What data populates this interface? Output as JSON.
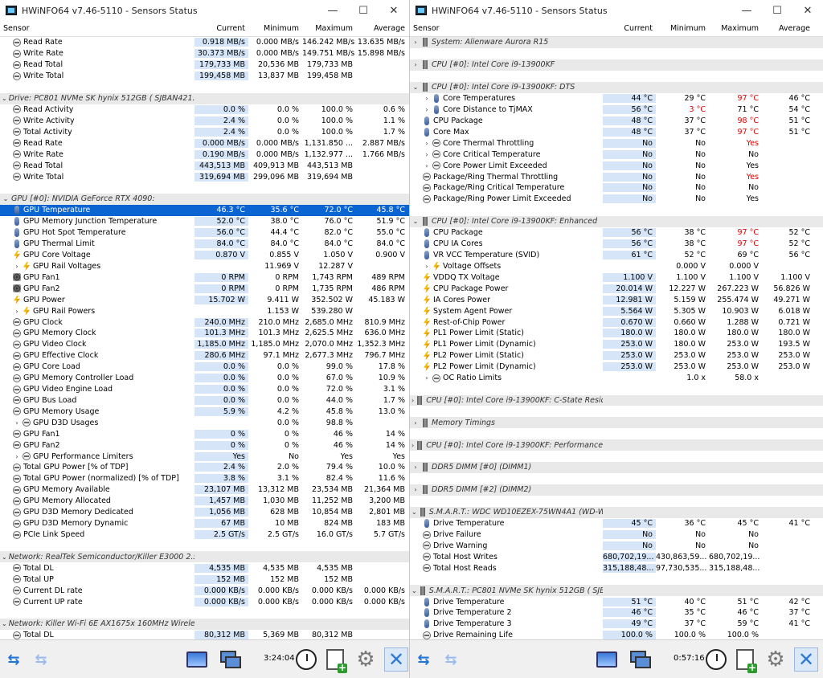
{
  "window_title": "HWiNFO64 v7.46-5110 - Sensors Status",
  "wctl": {
    "min": "—",
    "max": "☐",
    "close": "✕"
  },
  "columns": {
    "sensor": "Sensor",
    "current": "Current",
    "minimum": "Minimum",
    "maximum": "Maximum",
    "average": "Average"
  },
  "left": {
    "rows": [
      {
        "t": "s",
        "icon": "clock",
        "lbl": "Read Rate",
        "cur": "0.918 MB/s",
        "min": "0.000 MB/s",
        "max": "146.242 MB/s",
        "avg": "13.635 MB/s"
      },
      {
        "t": "s",
        "icon": "clock",
        "lbl": "Write Rate",
        "cur": "30.373 MB/s",
        "min": "0.000 MB/s",
        "max": "149.751 MB/s",
        "avg": "15.898 MB/s"
      },
      {
        "t": "s",
        "icon": "clock",
        "lbl": "Read Total",
        "cur": "179,733 MB",
        "min": "20,536 MB",
        "max": "179,733 MB",
        "avg": ""
      },
      {
        "t": "s",
        "icon": "clock",
        "lbl": "Write Total",
        "cur": "199,458 MB",
        "min": "13,837 MB",
        "max": "199,458 MB",
        "avg": ""
      },
      {
        "t": "b"
      },
      {
        "t": "g",
        "exp": "⌄",
        "lbl": "Drive: PC801 NVMe SK hynix 512GB (  SJBAN421..."
      },
      {
        "t": "s",
        "icon": "clock",
        "lbl": "Read Activity",
        "cur": "0.0 %",
        "min": "0.0 %",
        "max": "100.0 %",
        "avg": "0.6 %"
      },
      {
        "t": "s",
        "icon": "clock",
        "lbl": "Write Activity",
        "cur": "2.4 %",
        "min": "0.0 %",
        "max": "100.0 %",
        "avg": "1.1 %"
      },
      {
        "t": "s",
        "icon": "clock",
        "lbl": "Total Activity",
        "cur": "2.4 %",
        "min": "0.0 %",
        "max": "100.0 %",
        "avg": "1.7 %"
      },
      {
        "t": "s",
        "icon": "clock",
        "lbl": "Read Rate",
        "cur": "0.000 MB/s",
        "min": "0.000 MB/s",
        "max": "1,131.850 ...",
        "avg": "2.887 MB/s"
      },
      {
        "t": "s",
        "icon": "clock",
        "lbl": "Write Rate",
        "cur": "0.190 MB/s",
        "min": "0.000 MB/s",
        "max": "1,132.977 ...",
        "avg": "1.766 MB/s"
      },
      {
        "t": "s",
        "icon": "clock",
        "lbl": "Read Total",
        "cur": "443,513 MB",
        "min": "409,913 MB",
        "max": "443,513 MB",
        "avg": ""
      },
      {
        "t": "s",
        "icon": "clock",
        "lbl": "Write Total",
        "cur": "319,694 MB",
        "min": "299,096 MB",
        "max": "319,694 MB",
        "avg": ""
      },
      {
        "t": "b"
      },
      {
        "t": "g",
        "exp": "⌄",
        "lbl": "GPU [#0]: NVIDIA GeForce RTX 4090:"
      },
      {
        "t": "s",
        "icon": "therm",
        "lbl": "GPU Temperature",
        "cur": "46.3 °C",
        "min": "35.6 °C",
        "max": "72.0 °C",
        "avg": "45.8 °C",
        "sel": true
      },
      {
        "t": "s",
        "icon": "therm",
        "lbl": "GPU Memory Junction Temperature",
        "cur": "52.0 °C",
        "min": "38.0 °C",
        "max": "76.0 °C",
        "avg": "51.9 °C"
      },
      {
        "t": "s",
        "icon": "therm",
        "lbl": "GPU Hot Spot Temperature",
        "cur": "56.0 °C",
        "min": "44.4 °C",
        "max": "82.0 °C",
        "avg": "55.0 °C"
      },
      {
        "t": "s",
        "icon": "therm",
        "lbl": "GPU Thermal Limit",
        "cur": "84.0 °C",
        "min": "84.0 °C",
        "max": "84.0 °C",
        "avg": "84.0 °C"
      },
      {
        "t": "s",
        "icon": "volt",
        "lbl": "GPU Core Voltage",
        "cur": "0.870 V",
        "min": "0.855 V",
        "max": "1.050 V",
        "avg": "0.900 V"
      },
      {
        "t": "s",
        "icon": "volt",
        "exp": "›",
        "lbl": "GPU Rail Voltages",
        "cur": "",
        "min": "11.969 V",
        "max": "12.287 V",
        "avg": ""
      },
      {
        "t": "s",
        "icon": "fan",
        "lbl": "GPU Fan1",
        "cur": "0 RPM",
        "min": "0 RPM",
        "max": "1,743 RPM",
        "avg": "489 RPM"
      },
      {
        "t": "s",
        "icon": "fan",
        "lbl": "GPU Fan2",
        "cur": "0 RPM",
        "min": "0 RPM",
        "max": "1,735 RPM",
        "avg": "486 RPM"
      },
      {
        "t": "s",
        "icon": "volt",
        "lbl": "GPU Power",
        "cur": "15.702 W",
        "min": "9.411 W",
        "max": "352.502 W",
        "avg": "45.183 W"
      },
      {
        "t": "s",
        "icon": "volt",
        "exp": "›",
        "lbl": "GPU Rail Powers",
        "cur": "",
        "min": "1.153 W",
        "max": "539.280 W",
        "avg": ""
      },
      {
        "t": "s",
        "icon": "clock",
        "lbl": "GPU Clock",
        "cur": "240.0 MHz",
        "min": "210.0 MHz",
        "max": "2,685.0 MHz",
        "avg": "810.9 MHz"
      },
      {
        "t": "s",
        "icon": "clock",
        "lbl": "GPU Memory Clock",
        "cur": "101.3 MHz",
        "min": "101.3 MHz",
        "max": "2,625.5 MHz",
        "avg": "636.0 MHz"
      },
      {
        "t": "s",
        "icon": "clock",
        "lbl": "GPU Video Clock",
        "cur": "1,185.0 MHz",
        "min": "1,185.0 MHz",
        "max": "2,070.0 MHz",
        "avg": "1,352.3 MHz"
      },
      {
        "t": "s",
        "icon": "clock",
        "lbl": "GPU Effective Clock",
        "cur": "280.6 MHz",
        "min": "97.1 MHz",
        "max": "2,677.3 MHz",
        "avg": "796.7 MHz"
      },
      {
        "t": "s",
        "icon": "clock",
        "lbl": "GPU Core Load",
        "cur": "0.0 %",
        "min": "0.0 %",
        "max": "99.0 %",
        "avg": "17.8 %"
      },
      {
        "t": "s",
        "icon": "clock",
        "lbl": "GPU Memory Controller Load",
        "cur": "0.0 %",
        "min": "0.0 %",
        "max": "67.0 %",
        "avg": "10.9 %"
      },
      {
        "t": "s",
        "icon": "clock",
        "lbl": "GPU Video Engine Load",
        "cur": "0.0 %",
        "min": "0.0 %",
        "max": "72.0 %",
        "avg": "3.1 %"
      },
      {
        "t": "s",
        "icon": "clock",
        "lbl": "GPU Bus Load",
        "cur": "0.0 %",
        "min": "0.0 %",
        "max": "44.0 %",
        "avg": "1.7 %"
      },
      {
        "t": "s",
        "icon": "clock",
        "lbl": "GPU Memory Usage",
        "cur": "5.9 %",
        "min": "4.2 %",
        "max": "45.8 %",
        "avg": "13.0 %"
      },
      {
        "t": "s",
        "icon": "clock",
        "exp": "›",
        "lbl": "GPU D3D Usages",
        "cur": "",
        "min": "0.0 %",
        "max": "98.8 %",
        "avg": ""
      },
      {
        "t": "s",
        "icon": "clock",
        "lbl": "GPU Fan1",
        "cur": "0 %",
        "min": "0 %",
        "max": "46 %",
        "avg": "14 %"
      },
      {
        "t": "s",
        "icon": "clock",
        "lbl": "GPU Fan2",
        "cur": "0 %",
        "min": "0 %",
        "max": "46 %",
        "avg": "14 %"
      },
      {
        "t": "s",
        "icon": "clock",
        "exp": "›",
        "lbl": "GPU Performance Limiters",
        "cur": "Yes",
        "min": "No",
        "max": "Yes",
        "avg": "Yes"
      },
      {
        "t": "s",
        "icon": "clock",
        "lbl": "Total GPU Power [% of TDP]",
        "cur": "2.4 %",
        "min": "2.0 %",
        "max": "79.4 %",
        "avg": "10.0 %"
      },
      {
        "t": "s",
        "icon": "clock",
        "lbl": "Total GPU Power (normalized) [% of TDP]",
        "cur": "3.8 %",
        "min": "3.1 %",
        "max": "82.4 %",
        "avg": "11.6 %"
      },
      {
        "t": "s",
        "icon": "clock",
        "lbl": "GPU Memory Available",
        "cur": "23,107 MB",
        "min": "13,312 MB",
        "max": "23,534 MB",
        "avg": "21,364 MB"
      },
      {
        "t": "s",
        "icon": "clock",
        "lbl": "GPU Memory Allocated",
        "cur": "1,457 MB",
        "min": "1,030 MB",
        "max": "11,252 MB",
        "avg": "3,200 MB"
      },
      {
        "t": "s",
        "icon": "clock",
        "lbl": "GPU D3D Memory Dedicated",
        "cur": "1,056 MB",
        "min": "628 MB",
        "max": "10,854 MB",
        "avg": "2,801 MB"
      },
      {
        "t": "s",
        "icon": "clock",
        "lbl": "GPU D3D Memory Dynamic",
        "cur": "67 MB",
        "min": "10 MB",
        "max": "824 MB",
        "avg": "183 MB"
      },
      {
        "t": "s",
        "icon": "clock",
        "lbl": "PCIe Link Speed",
        "cur": "2.5 GT/s",
        "min": "2.5 GT/s",
        "max": "16.0 GT/s",
        "avg": "5.7 GT/s"
      },
      {
        "t": "b"
      },
      {
        "t": "g",
        "exp": "⌄",
        "lbl": "Network: RealTek Semiconductor/Killer E3000 2.5 ..."
      },
      {
        "t": "s",
        "icon": "clock",
        "lbl": "Total DL",
        "cur": "4,535 MB",
        "min": "4,535 MB",
        "max": "4,535 MB",
        "avg": ""
      },
      {
        "t": "s",
        "icon": "clock",
        "lbl": "Total UP",
        "cur": "152 MB",
        "min": "152 MB",
        "max": "152 MB",
        "avg": ""
      },
      {
        "t": "s",
        "icon": "clock",
        "lbl": "Current DL rate",
        "cur": "0.000 KB/s",
        "min": "0.000 KB/s",
        "max": "0.000 KB/s",
        "avg": "0.000 KB/s"
      },
      {
        "t": "s",
        "icon": "clock",
        "lbl": "Current UP rate",
        "cur": "0.000 KB/s",
        "min": "0.000 KB/s",
        "max": "0.000 KB/s",
        "avg": "0.000 KB/s"
      },
      {
        "t": "b"
      },
      {
        "t": "g",
        "exp": "⌄",
        "lbl": "Network: Killer Wi-Fi 6E AX1675x 160MHz Wireles..."
      },
      {
        "t": "s",
        "icon": "clock",
        "lbl": "Total DL",
        "cur": "80,312 MB",
        "min": "5,369 MB",
        "max": "80,312 MB",
        "avg": ""
      }
    ],
    "time": "3:24:04"
  },
  "right": {
    "rows": [
      {
        "t": "g",
        "exp": "›",
        "icon": "drive",
        "lbl": "System: Alienware Aurora R15"
      },
      {
        "t": "b"
      },
      {
        "t": "g",
        "exp": "›",
        "icon": "drive",
        "lbl": "CPU [#0]: Intel Core i9-13900KF"
      },
      {
        "t": "b"
      },
      {
        "t": "g",
        "exp": "⌄",
        "icon": "drive",
        "lbl": "CPU [#0]: Intel Core i9-13900KF: DTS"
      },
      {
        "t": "s",
        "icon": "therm",
        "exp": "›",
        "lbl": "Core Temperatures",
        "cur": "44 °C",
        "min": "29 °C",
        "max": "97 °C",
        "avg": "46 °C",
        "maxred": true
      },
      {
        "t": "s",
        "icon": "therm",
        "exp": "›",
        "lbl": "Core Distance to TjMAX",
        "cur": "56 °C",
        "min": "3 °C",
        "max": "71 °C",
        "avg": "54 °C",
        "minred": true
      },
      {
        "t": "s",
        "icon": "therm",
        "lbl": "CPU Package",
        "cur": "48 °C",
        "min": "37 °C",
        "max": "98 °C",
        "avg": "51 °C",
        "maxred": true
      },
      {
        "t": "s",
        "icon": "therm",
        "lbl": "Core Max",
        "cur": "48 °C",
        "min": "37 °C",
        "max": "97 °C",
        "avg": "51 °C",
        "maxred": true
      },
      {
        "t": "s",
        "icon": "clock",
        "exp": "›",
        "lbl": "Core Thermal Throttling",
        "cur": "No",
        "min": "No",
        "max": "Yes",
        "avg": "",
        "maxred": true
      },
      {
        "t": "s",
        "icon": "clock",
        "exp": "›",
        "lbl": "Core Critical Temperature",
        "cur": "No",
        "min": "No",
        "max": "No",
        "avg": ""
      },
      {
        "t": "s",
        "icon": "clock",
        "exp": "›",
        "lbl": "Core Power Limit Exceeded",
        "cur": "No",
        "min": "No",
        "max": "Yes",
        "avg": ""
      },
      {
        "t": "s",
        "icon": "clock",
        "lbl": "Package/Ring Thermal Throttling",
        "cur": "No",
        "min": "No",
        "max": "Yes",
        "avg": "",
        "maxred": true
      },
      {
        "t": "s",
        "icon": "clock",
        "lbl": "Package/Ring Critical Temperature",
        "cur": "No",
        "min": "No",
        "max": "No",
        "avg": ""
      },
      {
        "t": "s",
        "icon": "clock",
        "lbl": "Package/Ring Power Limit Exceeded",
        "cur": "No",
        "min": "No",
        "max": "Yes",
        "avg": ""
      },
      {
        "t": "b"
      },
      {
        "t": "g",
        "exp": "⌄",
        "icon": "drive",
        "lbl": "CPU [#0]: Intel Core i9-13900KF: Enhanced"
      },
      {
        "t": "s",
        "icon": "therm",
        "lbl": "CPU Package",
        "cur": "56 °C",
        "min": "38 °C",
        "max": "97 °C",
        "avg": "52 °C",
        "maxred": true
      },
      {
        "t": "s",
        "icon": "therm",
        "lbl": "CPU IA Cores",
        "cur": "56 °C",
        "min": "38 °C",
        "max": "97 °C",
        "avg": "52 °C",
        "maxred": true
      },
      {
        "t": "s",
        "icon": "therm",
        "lbl": "VR VCC Temperature (SVID)",
        "cur": "61 °C",
        "min": "52 °C",
        "max": "69 °C",
        "avg": "56 °C"
      },
      {
        "t": "s",
        "icon": "volt",
        "exp": "›",
        "lbl": "Voltage Offsets",
        "cur": "",
        "min": "0.000 V",
        "max": "0.000 V",
        "avg": ""
      },
      {
        "t": "s",
        "icon": "volt",
        "lbl": "VDDQ TX Voltage",
        "cur": "1.100 V",
        "min": "1.100 V",
        "max": "1.100 V",
        "avg": "1.100 V"
      },
      {
        "t": "s",
        "icon": "volt",
        "lbl": "CPU Package Power",
        "cur": "20.014 W",
        "min": "12.227 W",
        "max": "267.223 W",
        "avg": "56.826 W"
      },
      {
        "t": "s",
        "icon": "volt",
        "lbl": "IA Cores Power",
        "cur": "12.981 W",
        "min": "5.159 W",
        "max": "255.474 W",
        "avg": "49.271 W"
      },
      {
        "t": "s",
        "icon": "volt",
        "lbl": "System Agent Power",
        "cur": "5.564 W",
        "min": "5.305 W",
        "max": "10.903 W",
        "avg": "6.018 W"
      },
      {
        "t": "s",
        "icon": "volt",
        "lbl": "Rest-of-Chip Power",
        "cur": "0.670 W",
        "min": "0.660 W",
        "max": "1.288 W",
        "avg": "0.721 W"
      },
      {
        "t": "s",
        "icon": "volt",
        "lbl": "PL1 Power Limit (Static)",
        "cur": "180.0 W",
        "min": "180.0 W",
        "max": "180.0 W",
        "avg": "180.0 W"
      },
      {
        "t": "s",
        "icon": "volt",
        "lbl": "PL1 Power Limit (Dynamic)",
        "cur": "253.0 W",
        "min": "180.0 W",
        "max": "253.0 W",
        "avg": "193.5 W"
      },
      {
        "t": "s",
        "icon": "volt",
        "lbl": "PL2 Power Limit (Static)",
        "cur": "253.0 W",
        "min": "253.0 W",
        "max": "253.0 W",
        "avg": "253.0 W"
      },
      {
        "t": "s",
        "icon": "volt",
        "lbl": "PL2 Power Limit (Dynamic)",
        "cur": "253.0 W",
        "min": "253.0 W",
        "max": "253.0 W",
        "avg": "253.0 W"
      },
      {
        "t": "s",
        "icon": "clock",
        "exp": "›",
        "lbl": "OC Ratio Limits",
        "cur": "",
        "min": "1.0 x",
        "max": "58.0 x",
        "avg": ""
      },
      {
        "t": "b"
      },
      {
        "t": "g",
        "exp": "›",
        "icon": "drive",
        "lbl": "CPU [#0]: Intel Core i9-13900KF: C-State Reside..."
      },
      {
        "t": "b"
      },
      {
        "t": "g",
        "exp": "›",
        "icon": "drive",
        "lbl": "Memory Timings"
      },
      {
        "t": "b"
      },
      {
        "t": "g",
        "exp": "›",
        "icon": "drive",
        "lbl": "CPU [#0]: Intel Core i9-13900KF: Performance Li..."
      },
      {
        "t": "b"
      },
      {
        "t": "g",
        "exp": "›",
        "icon": "drive",
        "lbl": "DDR5 DIMM [#0] (DIMM1)"
      },
      {
        "t": "b"
      },
      {
        "t": "g",
        "exp": "›",
        "icon": "drive",
        "lbl": "DDR5 DIMM [#2] (DIMM2)"
      },
      {
        "t": "b"
      },
      {
        "t": "g",
        "exp": "⌄",
        "icon": "drive",
        "lbl": "S.M.A.R.T.: WDC WD10EZEX-75WN4A1 (WD-WC..."
      },
      {
        "t": "s",
        "icon": "therm",
        "lbl": "Drive Temperature",
        "cur": "45 °C",
        "min": "36 °C",
        "max": "45 °C",
        "avg": "41 °C"
      },
      {
        "t": "s",
        "icon": "clock",
        "lbl": "Drive Failure",
        "cur": "No",
        "min": "No",
        "max": "No",
        "avg": ""
      },
      {
        "t": "s",
        "icon": "clock",
        "lbl": "Drive Warning",
        "cur": "No",
        "min": "No",
        "max": "No",
        "avg": ""
      },
      {
        "t": "s",
        "icon": "clock",
        "lbl": "Total Host Writes",
        "cur": "680,702,19...",
        "min": "430,863,59...",
        "max": "680,702,19...",
        "avg": "",
        "wide": true
      },
      {
        "t": "s",
        "icon": "clock",
        "lbl": "Total Host Reads",
        "cur": "315,188,48...",
        "min": "97,730,535...",
        "max": "315,188,48...",
        "avg": "",
        "wide": true
      },
      {
        "t": "b"
      },
      {
        "t": "g",
        "exp": "⌄",
        "icon": "drive",
        "lbl": "S.M.A.R.T.: PC801 NVMe SK hynix 512GB (  SJBA..."
      },
      {
        "t": "s",
        "icon": "therm",
        "lbl": "Drive Temperature",
        "cur": "51 °C",
        "min": "40 °C",
        "max": "51 °C",
        "avg": "42 °C"
      },
      {
        "t": "s",
        "icon": "therm",
        "lbl": "Drive Temperature 2",
        "cur": "46 °C",
        "min": "35 °C",
        "max": "46 °C",
        "avg": "37 °C"
      },
      {
        "t": "s",
        "icon": "therm",
        "lbl": "Drive Temperature 3",
        "cur": "49 °C",
        "min": "37 °C",
        "max": "59 °C",
        "avg": "41 °C"
      },
      {
        "t": "s",
        "icon": "clock",
        "lbl": "Drive Remaining Life",
        "cur": "100.0 %",
        "min": "100.0 %",
        "max": "100.0 %",
        "avg": ""
      }
    ],
    "time": "0:57:16"
  }
}
